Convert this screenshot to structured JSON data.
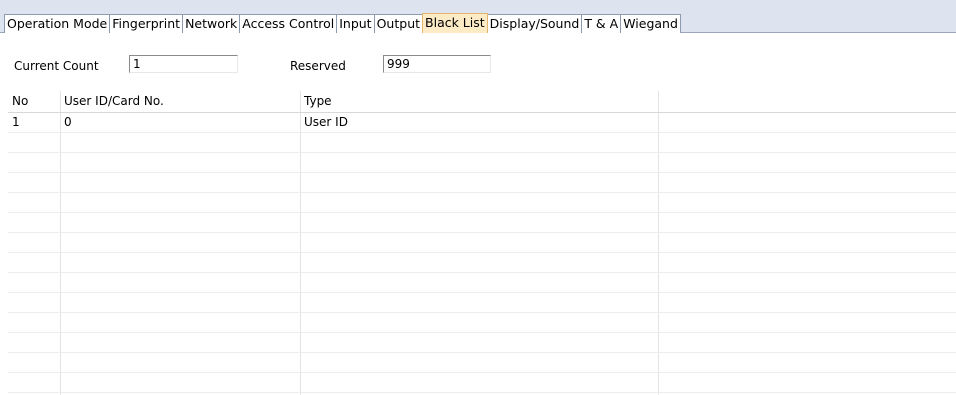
{
  "tabs": [
    {
      "label": "Operation Mode",
      "active": false
    },
    {
      "label": "Fingerprint",
      "active": false
    },
    {
      "label": "Network",
      "active": false
    },
    {
      "label": "Access Control",
      "active": false
    },
    {
      "label": "Input",
      "active": false
    },
    {
      "label": "Output",
      "active": false
    },
    {
      "label": "Black List",
      "active": true
    },
    {
      "label": "Display/Sound",
      "active": false
    },
    {
      "label": "T & A",
      "active": false
    },
    {
      "label": "Wiegand",
      "active": false
    }
  ],
  "summary": {
    "current_count_label": "Current Count",
    "current_count_value": "1",
    "reserved_label": "Reserved",
    "reserved_value": "999"
  },
  "table": {
    "columns": [
      "No",
      "User ID/Card No.",
      "Type"
    ],
    "rows": [
      [
        "1",
        "0",
        "User ID"
      ],
      [
        "",
        "",
        ""
      ],
      [
        "",
        "",
        ""
      ],
      [
        "",
        "",
        ""
      ],
      [
        "",
        "",
        ""
      ],
      [
        "",
        "",
        ""
      ],
      [
        "",
        "",
        ""
      ],
      [
        "",
        "",
        ""
      ],
      [
        "",
        "",
        ""
      ],
      [
        "",
        "",
        ""
      ],
      [
        "",
        "",
        ""
      ],
      [
        "",
        "",
        ""
      ],
      [
        "",
        "",
        ""
      ],
      [
        "",
        "",
        ""
      ]
    ]
  },
  "colors": {
    "tabbar_bg": "#dde4ef",
    "active_tab_bg": "#fdebc6",
    "active_tab_border": "#e2b56b"
  }
}
